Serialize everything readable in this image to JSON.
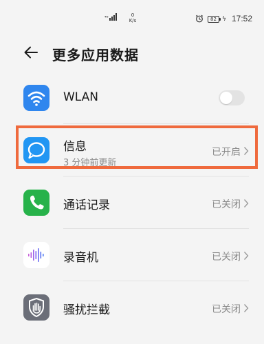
{
  "status_bar": {
    "signal_text": "⁴⁶",
    "net_speed_value": "0",
    "net_speed_unit": "K/s",
    "battery_level": "82",
    "time": "17:52"
  },
  "header": {
    "title": "更多应用数据"
  },
  "items": [
    {
      "label": "WLAN",
      "icon": "wifi-icon",
      "toggle_on": false
    },
    {
      "label": "信息",
      "subtitle": "3 分钟前更新",
      "status": "已开启",
      "icon": "message-icon"
    },
    {
      "label": "通话记录",
      "status": "已关闭",
      "icon": "phone-icon"
    },
    {
      "label": "录音机",
      "status": "已关闭",
      "icon": "soundwave-icon"
    },
    {
      "label": "骚扰拦截",
      "status": "已关闭",
      "icon": "hand-shield-icon"
    }
  ],
  "colors": {
    "highlight": "#ef6a3d",
    "wlan_icon": "#2f86ee",
    "message_icon": "#2196f3",
    "phone_icon": "#27b24a"
  }
}
